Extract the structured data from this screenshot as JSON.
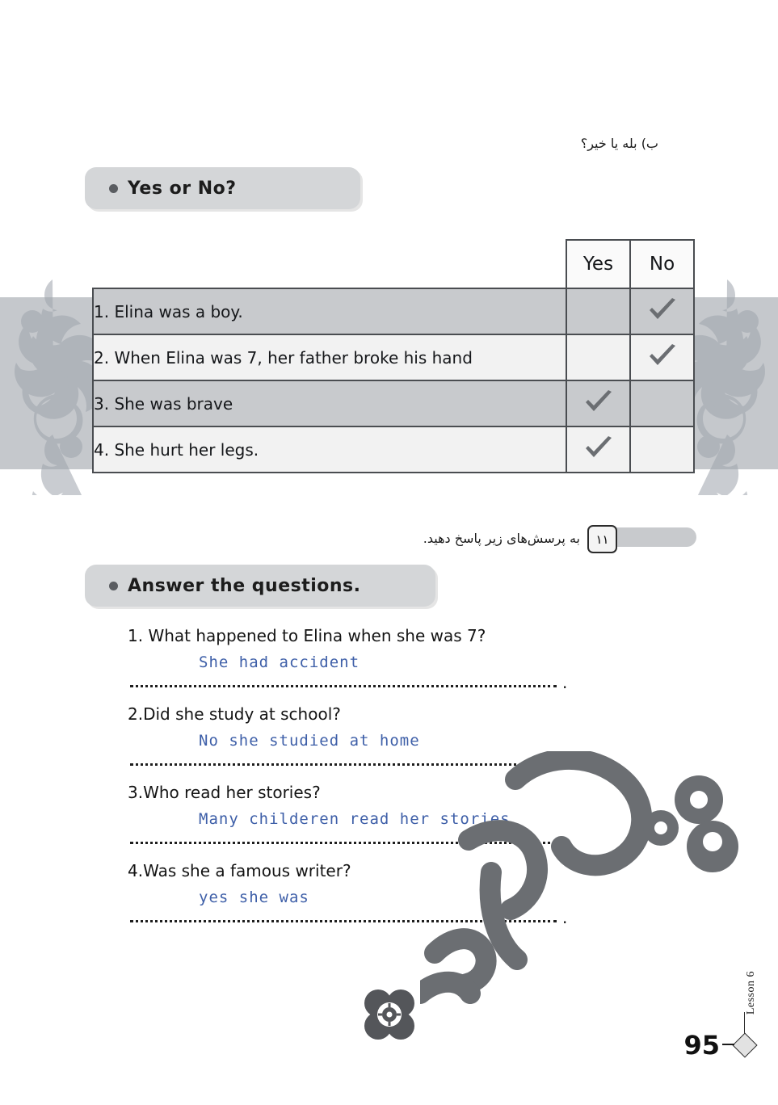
{
  "page": {
    "number": "95",
    "lesson_label": "Lesson 6"
  },
  "section_b": {
    "persian_instruction": "ب) بله یا خیر؟",
    "pill_label": "Yes or No?",
    "bullet_icon": "bullet-dot-icon",
    "table": {
      "columns": [
        "Yes",
        "No"
      ],
      "rows": [
        {
          "statement": "1. Elina was a boy.",
          "yes": false,
          "no": true
        },
        {
          "statement": "2. When Elina was 7, her father broke his hand",
          "yes": false,
          "no": true
        },
        {
          "statement": "3. She was brave",
          "yes": true,
          "no": false
        },
        {
          "statement": "4. She hurt her legs.",
          "yes": true,
          "no": false
        }
      ],
      "check_icon": "check-mark-icon"
    }
  },
  "section_11": {
    "number": "۱۱",
    "persian_instruction": "به پرسش‌های زیر پاسخ دهید.",
    "pill_label": "Answer the questions.",
    "bullet_icon": "bullet-dot-icon",
    "questions": [
      {
        "prompt": "1. What happened to Elina when she was 7?",
        "answer": "She had accident",
        "period": "."
      },
      {
        "prompt": "2.Did she study at school?",
        "answer": "No she studied at home",
        "period": "."
      },
      {
        "prompt": "3.Who read her stories?",
        "answer": "Many childeren read her stories",
        "period": "."
      },
      {
        "prompt": "4.Was she a famous writer?",
        "answer": "yes she was",
        "period": "."
      }
    ]
  },
  "decorations": {
    "left_ornament": "floral-scroll-ornament-icon",
    "right_ornament": "floral-scroll-ornament-icon",
    "flower": "four-petal-flower-icon",
    "watermark": "persian-calligraphy-watermark",
    "band_color": "#c5c8cc",
    "pill_color": "#d4d6d8",
    "answer_ink_color": "#3e5fa8",
    "row_dark_color": "#c8cacd",
    "row_light_color": "#f2f2f2",
    "border_color": "#4a4d51"
  }
}
